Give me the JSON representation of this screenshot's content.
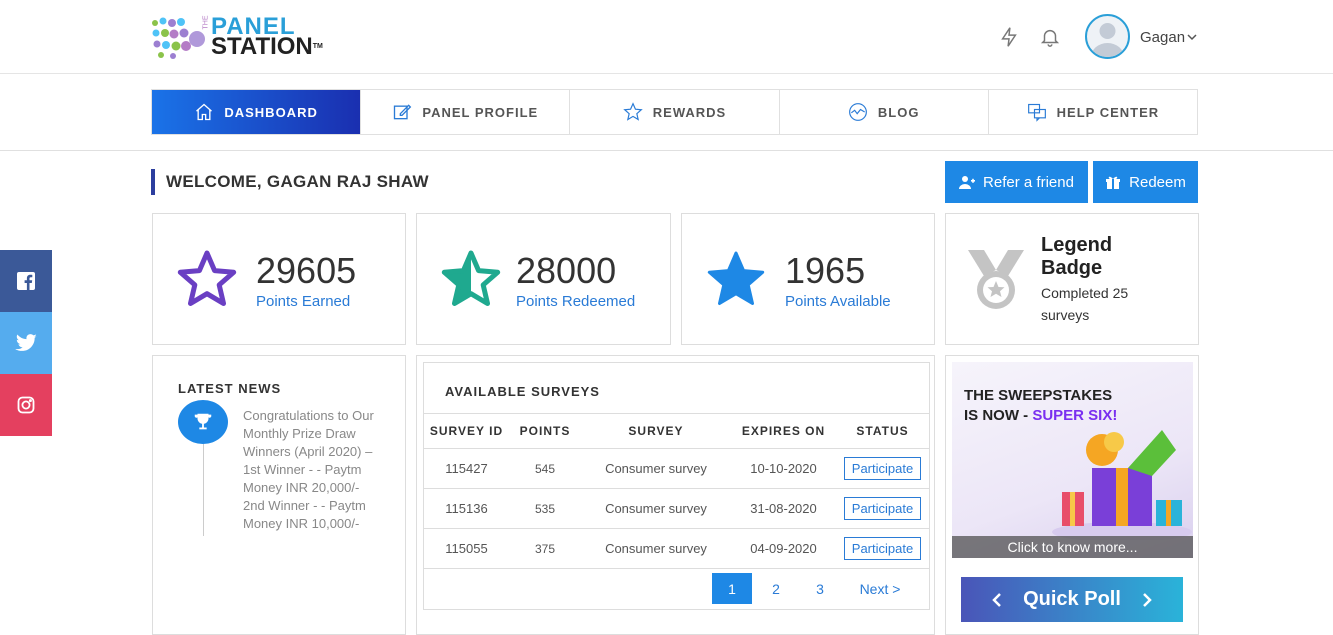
{
  "header": {
    "logo_line1": "PANEL",
    "logo_line2": "STATION",
    "logo_the": "THE",
    "logo_tm": "TM",
    "user_name": "Gagan"
  },
  "nav": {
    "items": [
      {
        "label": "DASHBOARD",
        "icon": "home-icon",
        "active": true
      },
      {
        "label": "PANEL PROFILE",
        "icon": "edit-icon"
      },
      {
        "label": "REWARDS",
        "icon": "star-icon"
      },
      {
        "label": "BLOG",
        "icon": "activity-icon"
      },
      {
        "label": "HELP CENTER",
        "icon": "chat-icon"
      }
    ]
  },
  "welcome": {
    "title": "WELCOME, GAGAN RAJ SHAW",
    "refer_label": "Refer a friend",
    "redeem_label": "Redeem"
  },
  "stats": [
    {
      "value": "29605",
      "label": "Points Earned",
      "color": "#6a3fc3"
    },
    {
      "value": "28000",
      "label": "Points Redeemed",
      "color": "#1fa98f"
    },
    {
      "value": "1965",
      "label": "Points Available",
      "color": "#1e88e5"
    }
  ],
  "badge": {
    "title": "Legend Badge",
    "subtitle": "Completed 25 surveys"
  },
  "news": {
    "title": "LATEST NEWS",
    "text": "Congratulations to Our Monthly Prize Draw Winners (April 2020) – 1st Winner - - Paytm Money INR 20,000/- 2nd Winner - - Paytm Money INR 10,000/-"
  },
  "surveys": {
    "title": "AVAILABLE SURVEYS",
    "columns": [
      "SURVEY ID",
      "POINTS",
      "SURVEY",
      "EXPIRES ON",
      "STATUS"
    ],
    "rows": [
      {
        "id": "115427",
        "points": "545",
        "survey": "Consumer survey",
        "expires": "10-10-2020",
        "status": "Participate"
      },
      {
        "id": "115136",
        "points": "535",
        "survey": "Consumer survey",
        "expires": "31-08-2020",
        "status": "Participate"
      },
      {
        "id": "115055",
        "points": "375",
        "survey": "Consumer survey",
        "expires": "04-09-2020",
        "status": "Participate"
      }
    ],
    "pages": [
      "1",
      "2",
      "3"
    ],
    "current_page": "1",
    "next_label": "Next >"
  },
  "promo": {
    "line1": "THE SWEEPSTAKES",
    "line2_prefix": "IS NOW - ",
    "line2_highlight": "SUPER SIX!",
    "caption": "Click to know more...",
    "poll_label": "Quick Poll"
  },
  "social": [
    {
      "icon": "facebook-icon",
      "color": "#3b5998"
    },
    {
      "icon": "twitter-icon",
      "color": "#55acee"
    },
    {
      "icon": "instagram-icon",
      "color": "#e4405f"
    }
  ]
}
